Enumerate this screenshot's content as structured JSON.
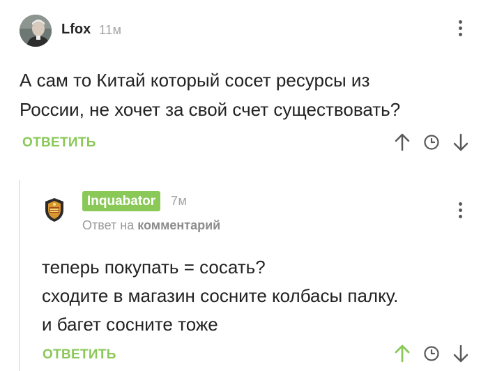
{
  "comment": {
    "author": "Lfox",
    "time": "11м",
    "lines": [
      "А сам то Китай который сосет ресурсы из",
      "России, не хочет за свой счет существовать?"
    ],
    "reply_label": "ОТВЕТИТЬ"
  },
  "reply": {
    "author": "Inquabator",
    "time": "7м",
    "reply_to_prefix": "Ответ на",
    "reply_to_link": "комментарий",
    "lines": [
      "теперь покупать = сосать?",
      "сходите в магазин сосните колбасы палку.",
      "и багет сосните тоже"
    ],
    "reply_label": "ОТВЕТИТЬ"
  },
  "icons": {
    "menu": "more-vertical-icon",
    "upvote": "arrow-up-icon",
    "save": "clock-icon",
    "downvote": "arrow-down-icon"
  },
  "colors": {
    "accent_green": "#8ac858",
    "icon_gray": "#595959",
    "meta_gray": "#a3a3a3"
  }
}
